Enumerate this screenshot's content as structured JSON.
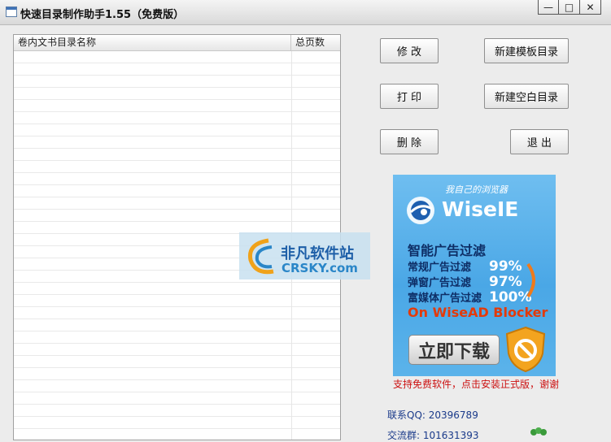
{
  "window": {
    "title": "快速目录制作助手1.55（免费版）",
    "controls": {
      "minimize": "—",
      "maximize": "□",
      "close": "✕"
    }
  },
  "list": {
    "columns": [
      "卷内文书目录名称",
      "总页数"
    ],
    "rows": []
  },
  "buttons": {
    "modify": "修  改",
    "print": "打  印",
    "delete": "删  除",
    "new_template": "新建模板目录",
    "new_blank": "新建空白目录",
    "exit": "退  出"
  },
  "ad": {
    "slogan": "我自己的浏览器",
    "brand": "WiseIE",
    "feature_title": "智能广告过滤",
    "features": [
      {
        "label": "常规广告过滤",
        "value": "99%"
      },
      {
        "label": "弹窗广告过滤",
        "value": "97%"
      },
      {
        "label": "富媒体广告过滤",
        "value": "100%"
      }
    ],
    "blocker": "On WiseAD Blocker",
    "download": "立即下载"
  },
  "support_text": "支持免费软件，点击安装正式版，谢谢",
  "contact": "联系QQ: 20396789",
  "contact2": "交流群: 101631393",
  "watermark": {
    "cn": "非凡软件站",
    "en": "CRSKY.com"
  },
  "colors": {
    "ad_bg": "#4aa7e6",
    "support_text": "#cc1111",
    "contact_text": "#1a3a8a"
  }
}
